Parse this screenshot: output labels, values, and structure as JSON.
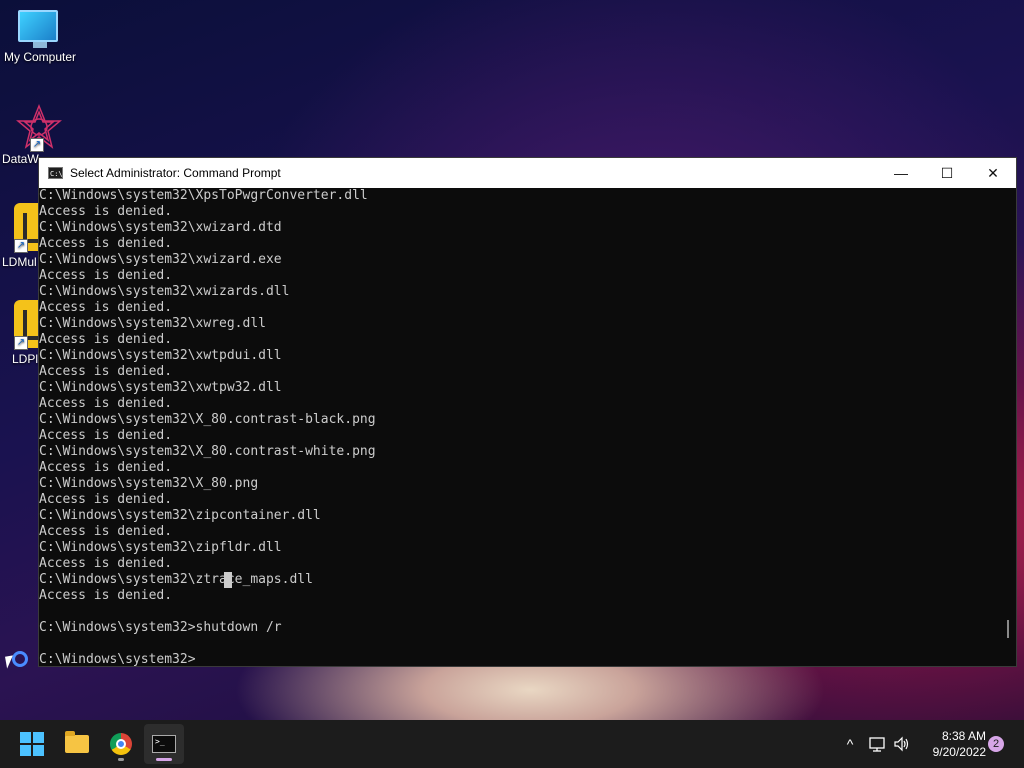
{
  "desktop": {
    "icons": [
      {
        "label": "My Computer",
        "icon": "monitor-icon"
      },
      {
        "label": "DataW",
        "icon": "datawiper-icon"
      },
      {
        "label": "LDMul",
        "icon": "ldmultiplayer-icon"
      },
      {
        "label": "LDPl",
        "icon": "ldplayer-icon"
      }
    ]
  },
  "window": {
    "title": "Select Administrator: Command Prompt",
    "minimize": "—",
    "maximize": "☐",
    "close": "✕",
    "console_lines": [
      "C:\\Windows\\system32\\XpsToPwgrConverter.dll",
      "Access is denied.",
      "C:\\Windows\\system32\\xwizard.dtd",
      "Access is denied.",
      "C:\\Windows\\system32\\xwizard.exe",
      "Access is denied.",
      "C:\\Windows\\system32\\xwizards.dll",
      "Access is denied.",
      "C:\\Windows\\system32\\xwreg.dll",
      "Access is denied.",
      "C:\\Windows\\system32\\xwtpdui.dll",
      "Access is denied.",
      "C:\\Windows\\system32\\xwtpw32.dll",
      "Access is denied.",
      "C:\\Windows\\system32\\X_80.contrast-black.png",
      "Access is denied.",
      "C:\\Windows\\system32\\X_80.contrast-white.png",
      "Access is denied.",
      "C:\\Windows\\system32\\X_80.png",
      "Access is denied.",
      "C:\\Windows\\system32\\zipcontainer.dll",
      "Access is denied.",
      "C:\\Windows\\system32\\zipfldr.dll",
      "Access is denied.",
      "C:\\Windows\\system32\\ztrace_maps.dll",
      "Access is denied.",
      "",
      "C:\\Windows\\system32>shutdown /r",
      "",
      "C:\\Windows\\system32>"
    ]
  },
  "taskbar": {
    "apps": [
      {
        "name": "start",
        "icon": "windows-start-icon"
      },
      {
        "name": "file-explorer",
        "icon": "folder-icon"
      },
      {
        "name": "chrome",
        "icon": "chrome-icon"
      },
      {
        "name": "command-prompt",
        "icon": "terminal-icon"
      }
    ],
    "tray": {
      "chevron": "^",
      "time": "8:38 AM",
      "date": "9/20/2022",
      "notification_count": "2"
    }
  }
}
